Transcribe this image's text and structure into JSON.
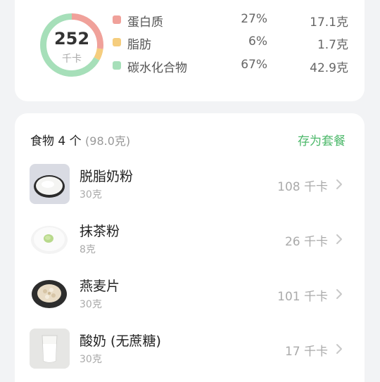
{
  "summary": {
    "kcal_value": "252",
    "kcal_unit": "千卡",
    "macros": [
      {
        "name": "蛋白质",
        "percent": "27%",
        "amount": "17.1克",
        "color": "#f0a19a",
        "fraction": 0.27
      },
      {
        "name": "脂肪",
        "percent": "6%",
        "amount": "1.7克",
        "color": "#f5cd7e",
        "fraction": 0.06
      },
      {
        "name": "碳水化合物",
        "percent": "67%",
        "amount": "42.9克",
        "color": "#a6dfb9",
        "fraction": 0.67
      }
    ]
  },
  "foods": {
    "title": "食物 4 个",
    "total_weight": "(98.0克)",
    "save_label": "存为套餐",
    "items": [
      {
        "name": "脱脂奶粉",
        "weight": "30克",
        "kcal": "108 千卡",
        "icon": "milk-powder"
      },
      {
        "name": "抹茶粉",
        "weight": "8克",
        "kcal": "26 千卡",
        "icon": "matcha-powder"
      },
      {
        "name": "燕麦片",
        "weight": "30克",
        "kcal": "101 千卡",
        "icon": "oat-flakes"
      },
      {
        "name": "酸奶 (无蔗糖)",
        "weight": "30克",
        "kcal": "17 千卡",
        "icon": "yogurt"
      }
    ]
  },
  "colors": {
    "accent": "#4cb86a",
    "background": "#f2f3f5",
    "card": "#ffffff"
  }
}
